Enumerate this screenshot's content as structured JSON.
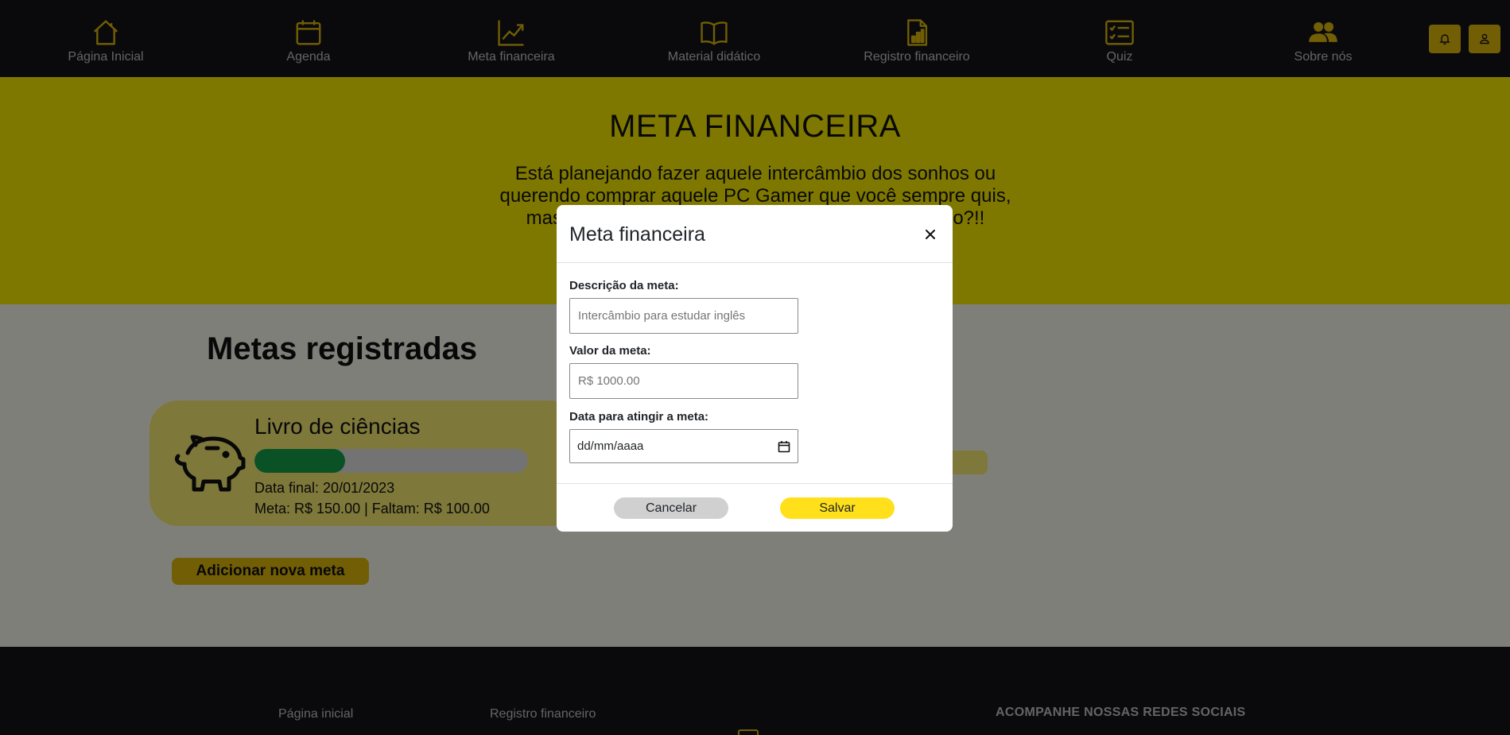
{
  "nav": {
    "items": [
      {
        "label": "Página Inicial",
        "icon": "home-icon"
      },
      {
        "label": "Agenda",
        "icon": "calendar-icon"
      },
      {
        "label": "Meta financeira",
        "icon": "chart-line-icon"
      },
      {
        "label": "Material didático",
        "icon": "book-icon"
      },
      {
        "label": "Registro financeiro",
        "icon": "file-chart-icon"
      },
      {
        "label": "Quiz",
        "icon": "checklist-icon"
      },
      {
        "label": "Sobre nós",
        "icon": "people-icon"
      }
    ],
    "icon_color": "#e2bd0b",
    "buttons": [
      {
        "icon": "bell-icon"
      },
      {
        "icon": "user-icon"
      }
    ]
  },
  "hero": {
    "title": "META FINANCEIRA",
    "text_line1": "Está planejando fazer aquele intercâmbio dos sonhos ou",
    "text_line2": "querendo comprar aquele PC Gamer que você sempre quis,",
    "text_line3_start": "mas",
    "text_line3_end": "ro?!!"
  },
  "goals": {
    "section_title": "Metas registradas",
    "items": [
      {
        "name": "Livro de ciências",
        "progress": 0.33,
        "date_line": "Data final: 20/01/2023",
        "amount_line": "Meta: R$ 150.00 | Faltam: R$ 100.00",
        "icon": "piggy-bank-icon"
      }
    ],
    "add_button": "Adicionar nova meta"
  },
  "footer": {
    "link1": "Página inicial",
    "link2": "Registro financeiro",
    "social_title": "ACOMPANHE NOSSAS REDES SOCIAIS"
  },
  "modal": {
    "title": "Meta financeira",
    "fields": {
      "description_label": "Descrição da meta:",
      "description_placeholder": "Intercâmbio para estudar inglês",
      "value_label": "Valor da meta:",
      "value_placeholder": "R$ 1000.00",
      "date_label": "Data para atingir a meta:",
      "date_placeholder": "dd/mm/aaaa"
    },
    "cancel_label": "Cancelar",
    "save_label": "Salvar"
  },
  "colors": {
    "accent": "#e2bd0b",
    "hero_bg": "#fff100",
    "progress": "#14a44d",
    "dark": "#141518"
  }
}
